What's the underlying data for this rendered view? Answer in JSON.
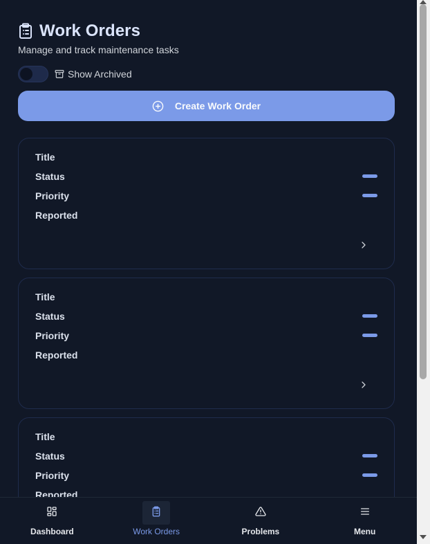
{
  "header": {
    "title": "Work Orders",
    "subtitle": "Manage and track maintenance tasks",
    "icon": "clipboard-list-icon"
  },
  "archived_toggle": {
    "label": "Show Archived",
    "enabled": false,
    "icon": "archive-icon"
  },
  "create_button": {
    "label": "Create Work Order",
    "icon": "plus-circle-icon"
  },
  "cards": [
    {
      "title_label": "Title",
      "status_label": "Status",
      "priority_label": "Priority",
      "reported_label": "Reported"
    },
    {
      "title_label": "Title",
      "status_label": "Status",
      "priority_label": "Priority",
      "reported_label": "Reported"
    },
    {
      "title_label": "Title",
      "status_label": "Status",
      "priority_label": "Priority",
      "reported_label": "Reported"
    }
  ],
  "bottom_nav": [
    {
      "label": "Dashboard",
      "icon": "layout-grid-icon",
      "active": false
    },
    {
      "label": "Work Orders",
      "icon": "clipboard-list-icon",
      "active": true
    },
    {
      "label": "Problems",
      "icon": "alert-triangle-icon",
      "active": false
    },
    {
      "label": "Menu",
      "icon": "menu-icon",
      "active": false
    }
  ],
  "colors": {
    "background": "#111827",
    "accent": "#7b9ae8",
    "card_border": "#1f2c4d",
    "title": "#dbe4fb"
  }
}
